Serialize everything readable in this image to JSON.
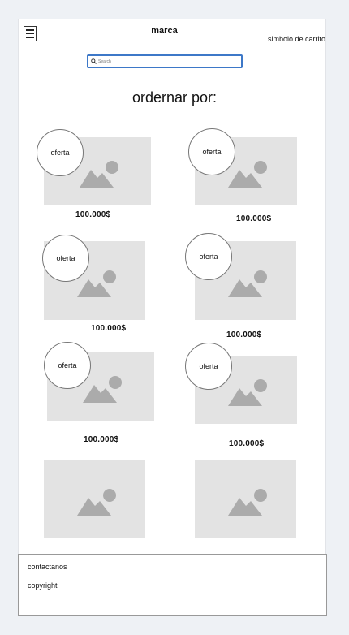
{
  "header": {
    "menu_icon": "hamburger-icon",
    "brand": "marca",
    "cart_label": "simbolo de carrito"
  },
  "search": {
    "placeholder": "Search",
    "icon": "search-icon"
  },
  "sort": {
    "title": "ordernar por:"
  },
  "products": [
    {
      "badge": "oferta",
      "price": "100.000$",
      "icon": "image-placeholder-icon"
    },
    {
      "badge": "oferta",
      "price": "100.000$",
      "icon": "image-placeholder-icon"
    },
    {
      "badge": "oferta",
      "price": "100.000$",
      "icon": "image-placeholder-icon"
    },
    {
      "badge": "oferta",
      "price": "100.000$",
      "icon": "image-placeholder-icon"
    },
    {
      "badge": "oferta",
      "price": "100.000$",
      "icon": "image-placeholder-icon"
    },
    {
      "badge": "oferta",
      "price": "100.000$",
      "icon": "image-placeholder-icon"
    },
    {
      "badge": "",
      "price": "",
      "icon": "image-placeholder-icon"
    },
    {
      "badge": "",
      "price": "",
      "icon": "image-placeholder-icon"
    }
  ],
  "footer": {
    "contact": "contactanos",
    "copyright": "copyright"
  },
  "colors": {
    "search_border": "#3d78c8",
    "placeholder_bg": "#e3e3e3",
    "placeholder_icon": "#ababab",
    "page_bg": "#eef1f5"
  }
}
